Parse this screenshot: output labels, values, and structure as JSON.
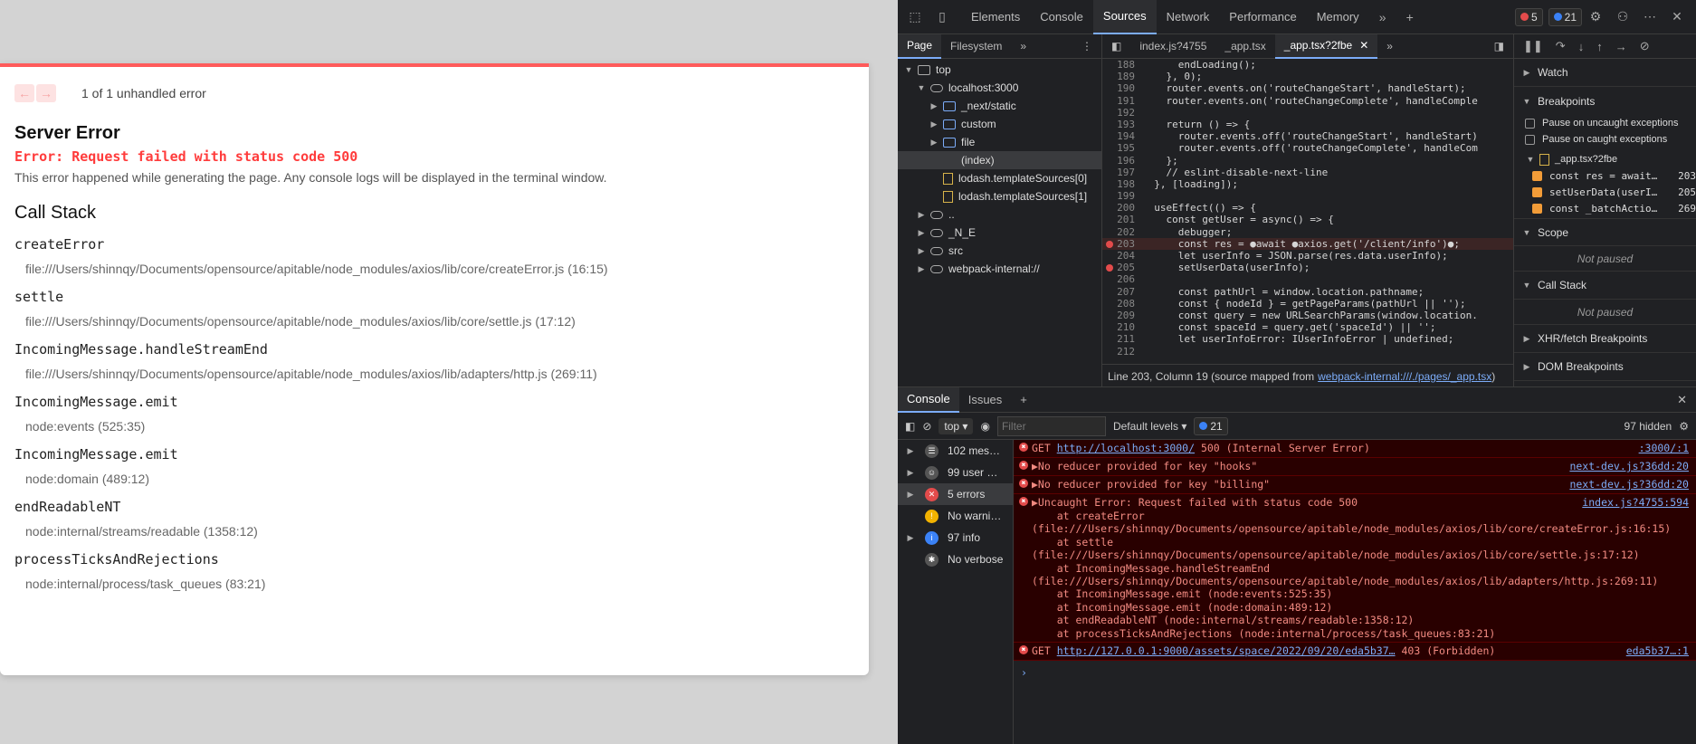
{
  "error_overlay": {
    "counter": "1 of 1 unhandled error",
    "title": "Server Error",
    "message": "Error: Request failed with status code 500",
    "description": "This error happened while generating the page. Any console logs will be displayed in the terminal window.",
    "call_stack_title": "Call Stack",
    "frames": [
      {
        "fn": "createError",
        "loc": "file:///Users/shinnqy/Documents/opensource/apitable/node_modules/axios/lib/core/createError.js (16:15)"
      },
      {
        "fn": "settle",
        "loc": "file:///Users/shinnqy/Documents/opensource/apitable/node_modules/axios/lib/core/settle.js (17:12)"
      },
      {
        "fn": "IncomingMessage.handleStreamEnd",
        "loc": "file:///Users/shinnqy/Documents/opensource/apitable/node_modules/axios/lib/adapters/http.js (269:11)"
      },
      {
        "fn": "IncomingMessage.emit",
        "loc": "node:events (525:35)"
      },
      {
        "fn": "IncomingMessage.emit",
        "loc": "node:domain (489:12)"
      },
      {
        "fn": "endReadableNT",
        "loc": "node:internal/streams/readable (1358:12)"
      },
      {
        "fn": "processTicksAndRejections",
        "loc": "node:internal/process/task_queues (83:21)"
      }
    ]
  },
  "devtools": {
    "tabs": [
      "Elements",
      "Console",
      "Sources",
      "Network",
      "Performance",
      "Memory"
    ],
    "active_tab": "Sources",
    "error_count": "5",
    "info_count": "21",
    "navigator": {
      "tabs": [
        "Page",
        "Filesystem"
      ],
      "tree": [
        {
          "label": "top",
          "indent": 0,
          "icon": "window",
          "arrow": "▼"
        },
        {
          "label": "localhost:3000",
          "indent": 1,
          "icon": "cloud",
          "arrow": "▼"
        },
        {
          "label": "_next/static",
          "indent": 2,
          "icon": "folder",
          "arrow": "▶"
        },
        {
          "label": "custom",
          "indent": 2,
          "icon": "folder",
          "arrow": "▶"
        },
        {
          "label": "file",
          "indent": 2,
          "icon": "folder",
          "arrow": "▶"
        },
        {
          "label": "(index)",
          "indent": 2,
          "icon": "none",
          "arrow": "",
          "selected": true
        },
        {
          "label": "lodash.templateSources[0]",
          "indent": 2,
          "icon": "file",
          "arrow": ""
        },
        {
          "label": "lodash.templateSources[1]",
          "indent": 2,
          "icon": "file",
          "arrow": ""
        },
        {
          "label": "..",
          "indent": 1,
          "icon": "cloud",
          "arrow": "▶"
        },
        {
          "label": "_N_E",
          "indent": 1,
          "icon": "cloud",
          "arrow": "▶"
        },
        {
          "label": "src",
          "indent": 1,
          "icon": "cloud",
          "arrow": "▶"
        },
        {
          "label": "webpack-internal://",
          "indent": 1,
          "icon": "cloud",
          "arrow": "▶"
        }
      ]
    },
    "editor": {
      "tabs": [
        "index.js?4755",
        "_app.tsx",
        "_app.tsx?2fbe"
      ],
      "active_tab": "_app.tsx?2fbe",
      "lines": [
        {
          "n": "188",
          "t": "      endLoading();"
        },
        {
          "n": "189",
          "t": "    }, 0);"
        },
        {
          "n": "190",
          "t": "    router.events.on('routeChangeStart', handleStart);"
        },
        {
          "n": "191",
          "t": "    router.events.on('routeChangeComplete', handleComple"
        },
        {
          "n": "192",
          "t": ""
        },
        {
          "n": "193",
          "t": "    return () => {"
        },
        {
          "n": "194",
          "t": "      router.events.off('routeChangeStart', handleStart)"
        },
        {
          "n": "195",
          "t": "      router.events.off('routeChangeComplete', handleCom"
        },
        {
          "n": "196",
          "t": "    };"
        },
        {
          "n": "197",
          "t": "    // eslint-disable-next-line"
        },
        {
          "n": "198",
          "t": "  }, [loading]);"
        },
        {
          "n": "199",
          "t": ""
        },
        {
          "n": "200",
          "t": "  useEffect(() => {"
        },
        {
          "n": "201",
          "t": "    const getUser = async() => {"
        },
        {
          "n": "202",
          "t": "      debugger;"
        },
        {
          "n": "203",
          "t": "      const res = ●await ●axios.get('/client/info')●;",
          "bp": true
        },
        {
          "n": "204",
          "t": "      let userInfo = JSON.parse(res.data.userInfo);"
        },
        {
          "n": "205",
          "t": "      setUserData(userInfo);",
          "bp": true
        },
        {
          "n": "206",
          "t": ""
        },
        {
          "n": "207",
          "t": "      const pathUrl = window.location.pathname;"
        },
        {
          "n": "208",
          "t": "      const { nodeId } = getPageParams(pathUrl || '');"
        },
        {
          "n": "209",
          "t": "      const query = new URLSearchParams(window.location."
        },
        {
          "n": "210",
          "t": "      const spaceId = query.get('spaceId') || '';"
        },
        {
          "n": "211",
          "t": "      let userInfoError: IUserInfoError | undefined;"
        },
        {
          "n": "212",
          "t": ""
        }
      ],
      "status_prefix": "Line 203, Column 19  (source mapped from",
      "status_link": "webpack-internal:///./pages/_app.tsx",
      "status_suffix": ")"
    },
    "debugger": {
      "watch": "Watch",
      "breakpoints": "Breakpoints",
      "pause_uncaught": "Pause on uncaught exceptions",
      "pause_caught": "Pause on caught exceptions",
      "bp_file": "_app.tsx?2fbe",
      "bps": [
        {
          "code": "const res = await…",
          "line": "203"
        },
        {
          "code": "setUserData(userI…",
          "line": "205"
        },
        {
          "code": "const _batchActio…",
          "line": "269"
        }
      ],
      "scope": "Scope",
      "not_paused": "Not paused",
      "call_stack": "Call Stack",
      "xhr": "XHR/fetch Breakpoints",
      "dom": "DOM Breakpoints"
    },
    "console": {
      "tabs": [
        "Console",
        "Issues"
      ],
      "context": "top",
      "filter_placeholder": "Filter",
      "levels": "Default levels",
      "issues_badge": "21",
      "hidden": "97 hidden",
      "sidebar": [
        {
          "label": "102 mes…",
          "icon": "list",
          "arrow": true
        },
        {
          "label": "99 user …",
          "icon": "user",
          "arrow": true
        },
        {
          "label": "5 errors",
          "icon": "error",
          "arrow": true,
          "selected": true
        },
        {
          "label": "No warni…",
          "icon": "warning",
          "arrow": false
        },
        {
          "label": "97 info",
          "icon": "info",
          "arrow": true
        },
        {
          "label": "No verbose",
          "icon": "verbose",
          "arrow": false
        }
      ],
      "msg1_prefix": "GET ",
      "msg1_link": "http://localhost:3000/",
      "msg1_suffix": " 500 (Internal Server Error)",
      "msg1_src": ":3000/:1",
      "msg2": "▶No reducer provided for key \"hooks\"",
      "msg2_src": "next-dev.js?36dd:20",
      "msg3": "▶No reducer provided for key \"billing\"",
      "msg3_src": "next-dev.js?36dd:20",
      "msg4_head": "▶Uncaught Error: Request failed with status code 500",
      "msg4_src": "index.js?4755:594",
      "msg4_stack": "    at createError (file:///Users/shinnqy/Documents/opensource/apitable/node_modules/axios/lib/core/createError.js:16:15)\n    at settle (file:///Users/shinnqy/Documents/opensource/apitable/node_modules/axios/lib/core/settle.js:17:12)\n    at IncomingMessage.handleStreamEnd (file:///Users/shinnqy/Documents/opensource/apitable/node_modules/axios/lib/adapters/http.js:269:11)\n    at IncomingMessage.emit (node:events:525:35)\n    at IncomingMessage.emit (node:domain:489:12)\n    at endReadableNT (node:internal/streams/readable:1358:12)\n    at processTicksAndRejections (node:internal/process/task_queues:83:21)",
      "msg5_prefix": "GET ",
      "msg5_link": "http://127.0.0.1:9000/assets/space/2022/09/20/eda5b37…",
      "msg5_suffix": " 403 (Forbidden)",
      "msg5_src": "eda5b37…:1",
      "prompt": "›"
    }
  }
}
